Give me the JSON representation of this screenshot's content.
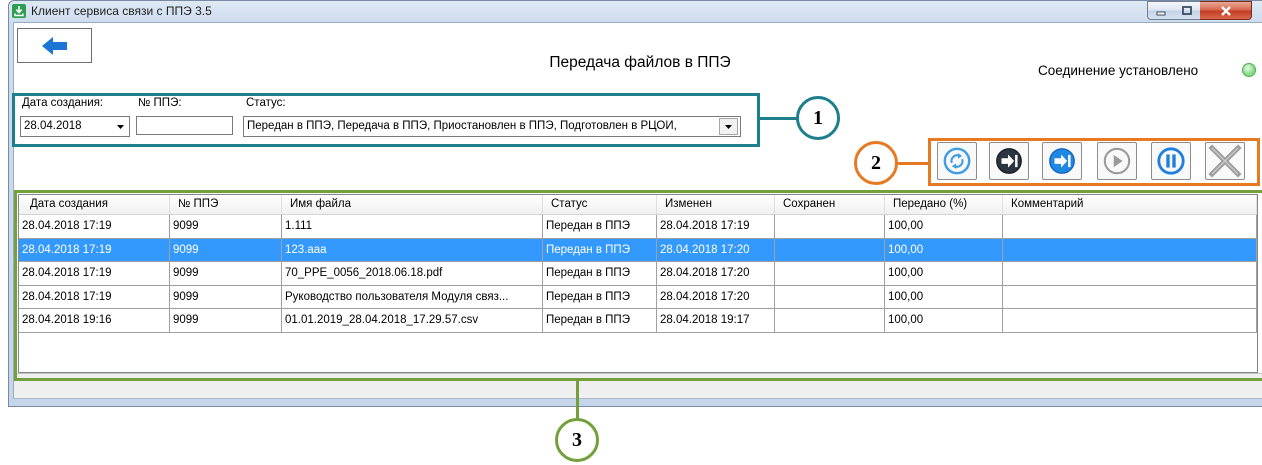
{
  "window": {
    "title": "Клиент сервиса связи с ППЭ 3.5",
    "app_icon": "download-app-icon",
    "controls": [
      "minimize-icon",
      "maximize-icon",
      "close-icon"
    ]
  },
  "header": {
    "back_icon": "arrow-left-icon",
    "title": "Передача файлов в ППЭ",
    "connection_status": "Соединение установлено",
    "connection_indicator_color": "#86d986"
  },
  "filters": {
    "date_label": "Дата создания:",
    "date_value": "28.04.2018",
    "ppe_label": "№ ППЭ:",
    "ppe_value": "",
    "status_label": "Статус:",
    "status_value": "Передан в ППЭ, Передача в ППЭ, Приостановлен в ППЭ, Подготовлен в РЦОИ, "
  },
  "toolbar": {
    "buttons": [
      {
        "icon": "refresh-icon",
        "enabled": true
      },
      {
        "icon": "import-icon",
        "enabled": true
      },
      {
        "icon": "send-icon",
        "enabled": true
      },
      {
        "icon": "play-icon",
        "enabled": false
      },
      {
        "icon": "pause-icon",
        "enabled": true
      },
      {
        "icon": "cancel-icon",
        "enabled": false
      }
    ]
  },
  "grid": {
    "columns": [
      "Дата создания",
      "№ ППЭ",
      "Имя файла",
      "Статус",
      "Изменен",
      "Сохранен",
      "Передано (%)",
      "Комментарий"
    ],
    "rows": [
      [
        "28.04.2018 17:19",
        "9099",
        "1.111",
        "Передан в ППЭ",
        "28.04.2018 17:19",
        "",
        "100,00",
        ""
      ],
      [
        "28.04.2018 17:19",
        "9099",
        "123.aaa",
        "Передан в ППЭ",
        "28.04.2018 17:20",
        "",
        "100,00",
        ""
      ],
      [
        "28.04.2018 17:19",
        "9099",
        "70_PPE_0056_2018.06.18.pdf",
        "Передан в ППЭ",
        "28.04.2018 17:20",
        "",
        "100,00",
        ""
      ],
      [
        "28.04.2018 17:19",
        "9099",
        "Руководство пользователя Модуля связ...",
        "Передан в ППЭ",
        "28.04.2018 17:20",
        "",
        "100,00",
        ""
      ],
      [
        "28.04.2018 19:16",
        "9099",
        "01.01.2019_28.04.2018_17.29.57.csv",
        "Передан в ППЭ",
        "28.04.2018 19:17",
        "",
        "100,00",
        ""
      ]
    ],
    "selected_row_index": 1,
    "selection_color": "#3399ff"
  },
  "annotations": [
    {
      "label": "1",
      "color": "#1d7e8c"
    },
    {
      "label": "2",
      "color": "#e67a22"
    },
    {
      "label": "3",
      "color": "#74a03c"
    }
  ]
}
